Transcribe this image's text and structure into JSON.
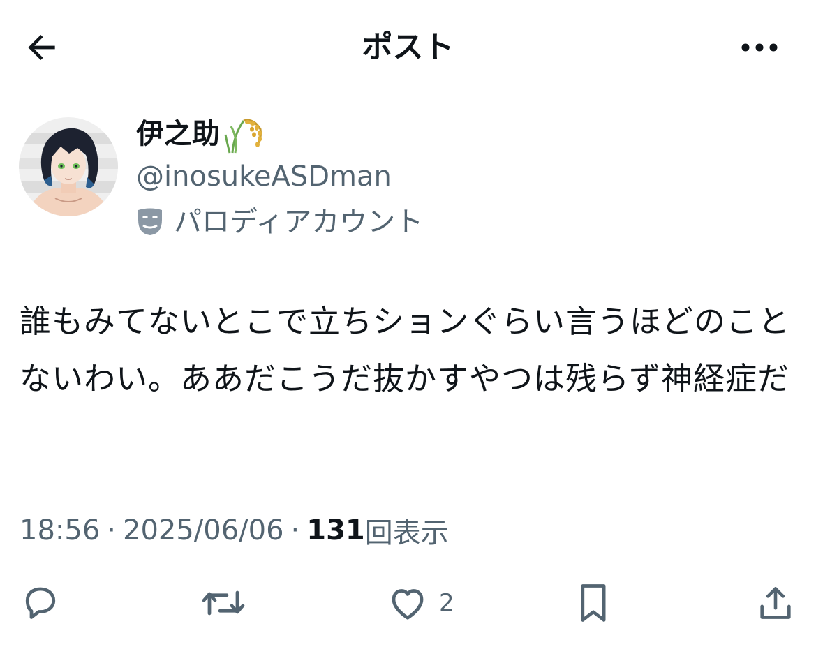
{
  "header": {
    "title": "ポスト",
    "back_icon": "arrow-left-icon",
    "more_icon": "more-horizontal-icon"
  },
  "author": {
    "name": "伊之助",
    "name_emoji_icon": "rice-plant-icon",
    "handle": "@inosukeASDman",
    "parody_label": "パロディアカウント",
    "parody_icon": "theater-mask-icon"
  },
  "tweet": {
    "text": "誰もみてないとこで立ちションぐらい言うほどのことないわい。ああだこうだ抜かすやつは残らず神経症だ"
  },
  "meta": {
    "time": "18:56",
    "separator": "·",
    "date": "2025/06/06",
    "views_count": "131",
    "views_label": "回表示"
  },
  "actions": {
    "reply_icon": "reply-icon",
    "retweet_icon": "retweet-icon",
    "like_icon": "heart-icon",
    "like_count": "2",
    "bookmark_icon": "bookmark-icon",
    "share_icon": "share-icon"
  },
  "colors": {
    "text_primary": "#0f1419",
    "text_secondary": "#536471",
    "background": "#ffffff"
  }
}
